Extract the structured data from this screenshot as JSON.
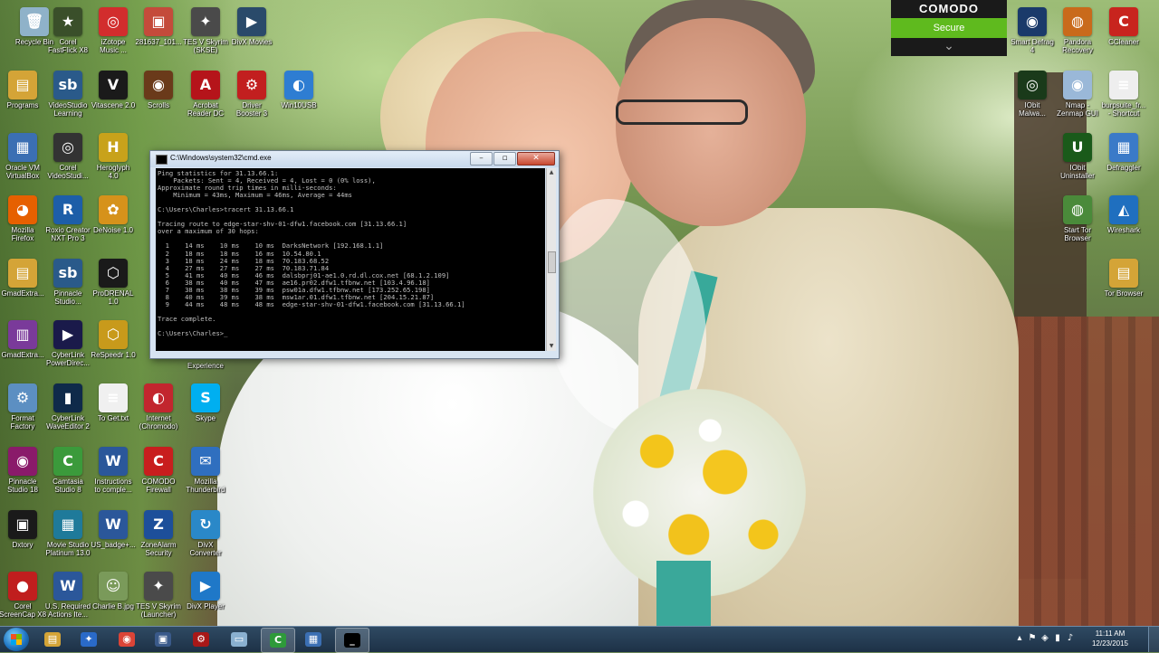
{
  "desktop": {
    "icons": [
      {
        "label": "Recycle Bin",
        "glyph": "🗑",
        "bg": "#8fb2c9"
      },
      {
        "label": "Corel\nFastFlick X8",
        "glyph": "★",
        "bg": "#3a4f2a"
      },
      {
        "label": "iZotope\nMusic ...",
        "glyph": "◎",
        "bg": "#d22d2d"
      },
      {
        "label": "281637_101...",
        "glyph": "▣",
        "bg": "#c44b3b"
      },
      {
        "label": "TES V Skyrim\n(SKSE)",
        "glyph": "✦",
        "bg": "#4a4a4a"
      },
      {
        "label": "DivX Movies",
        "glyph": "▶",
        "bg": "#2a4a6a"
      },
      {
        "label": "Programs",
        "glyph": "▤",
        "bg": "#d4a437"
      },
      {
        "label": "VideoStudio\nLearning",
        "glyph": "sb",
        "bg": "#2a5a8a"
      },
      {
        "label": "Vitascene 2.0",
        "glyph": "V",
        "bg": "#1a1a1a"
      },
      {
        "label": "Scrolls",
        "glyph": "◉",
        "bg": "#6a3a1a"
      },
      {
        "label": "Acrobat\nReader DC",
        "glyph": "A",
        "bg": "#b5141a"
      },
      {
        "label": "Driver\nBooster 3",
        "glyph": "⚙",
        "bg": "#c21f1f"
      },
      {
        "label": "Win10USB",
        "glyph": "◐",
        "bg": "#2e7dd2"
      },
      {
        "label": "Oracle VM\nVirtualBox",
        "glyph": "▦",
        "bg": "#3b6fb3"
      },
      {
        "label": "Corel\nVideoStudi...",
        "glyph": "◎",
        "bg": "#333"
      },
      {
        "label": "Heroglyph\n4.0",
        "glyph": "H",
        "bg": "#c8a21b"
      },
      {
        "label": "Mozilla\nFirefox",
        "glyph": "◕",
        "bg": "#e66000"
      },
      {
        "label": "Roxio Creator\nNXT Pro 3",
        "glyph": "R",
        "bg": "#1d5ea8"
      },
      {
        "label": "DeNoise 1.0",
        "glyph": "✿",
        "bg": "#d6921b"
      },
      {
        "label": "GmadExtra...",
        "glyph": "▤",
        "bg": "#d4a437"
      },
      {
        "label": "Pinnacle\nStudio...",
        "glyph": "sb",
        "bg": "#2a5a8a"
      },
      {
        "label": "ProDRENAL\n1.0",
        "glyph": "⬡",
        "bg": "#1a1a1a"
      },
      {
        "label": "GmadExtra...",
        "glyph": "▥",
        "bg": "#7a3a9a"
      },
      {
        "label": "CyberLink\nPowerDirec...",
        "glyph": "▶",
        "bg": "#1a1a4a"
      },
      {
        "label": "ReSpeedr 1.0",
        "glyph": "⬡",
        "bg": "#c89a1b"
      },
      {
        "label": "Experience",
        "glyph": "",
        "bg": "transparent"
      },
      {
        "label": "Format\nFactory",
        "glyph": "⚙",
        "bg": "#5c8fc2"
      },
      {
        "label": "CyberLink\nWaveEditor 2",
        "glyph": "▮",
        "bg": "#0f2a4a"
      },
      {
        "label": "To Get.txt",
        "glyph": "≡",
        "bg": "#f0f0f0"
      },
      {
        "label": "Internet\n(Chromodo)",
        "glyph": "◐",
        "bg": "#c2262e"
      },
      {
        "label": "Skype",
        "glyph": "S",
        "bg": "#00aff0"
      },
      {
        "label": "Pinnacle\nStudio 18",
        "glyph": "◉",
        "bg": "#8a1a6a"
      },
      {
        "label": "Camtasia\nStudio 8",
        "glyph": "C",
        "bg": "#3b9a3b"
      },
      {
        "label": "Instructions\nto comple...",
        "glyph": "W",
        "bg": "#2b579a"
      },
      {
        "label": "COMODO\nFirewall",
        "glyph": "C",
        "bg": "#c81e1e"
      },
      {
        "label": "Mozilla\nThunderbird",
        "glyph": "✉",
        "bg": "#2f6fbf"
      },
      {
        "label": "Dxtory",
        "glyph": "▣",
        "bg": "#1a1a1a"
      },
      {
        "label": "Movie Studio\nPlatinum 13.0",
        "glyph": "▦",
        "bg": "#1f7a9a"
      },
      {
        "label": "US_badge+...",
        "glyph": "W",
        "bg": "#2b579a"
      },
      {
        "label": "ZoneAlarm\nSecurity",
        "glyph": "Z",
        "bg": "#1d4f9a"
      },
      {
        "label": "DivX\nConverter",
        "glyph": "↻",
        "bg": "#2a88c8"
      },
      {
        "label": "Corel\nScreenCap X8",
        "glyph": "●",
        "bg": "#c01e1e"
      },
      {
        "label": "U.S. Required\nActions Ite...",
        "glyph": "W",
        "bg": "#2b579a"
      },
      {
        "label": "Charlie B.jpg",
        "glyph": "☺",
        "bg": "#7a9a5a"
      },
      {
        "label": "TES V Skyrim\n(Launcher)",
        "glyph": "✦",
        "bg": "#4a4a4a"
      },
      {
        "label": "DivX Player",
        "glyph": "▶",
        "bg": "#1f78c8"
      },
      {
        "label": "Smart Defrag\n4",
        "glyph": "◉",
        "bg": "#1a3a6a"
      },
      {
        "label": "Pandora\nRecovery",
        "glyph": "◍",
        "bg": "#c96a1b"
      },
      {
        "label": "CCleaner",
        "glyph": "C",
        "bg": "#c8241e"
      },
      {
        "label": "IObit\nMalwa...",
        "glyph": "◎",
        "bg": "#1a3a1a"
      },
      {
        "label": "Nmap -\nZenmap GUI",
        "glyph": "◉",
        "bg": "#9ab8d8"
      },
      {
        "label": "burpsuite_fr...\n- Shortcut",
        "glyph": "≡",
        "bg": "#eeeeee"
      },
      {
        "label": "IObit\nUninstaller",
        "glyph": "U",
        "bg": "#1a5a1a"
      },
      {
        "label": "Defraggler",
        "glyph": "▦",
        "bg": "#3a7ac8"
      },
      {
        "label": "Start Tor\nBrowser",
        "glyph": "◍",
        "bg": "#4a8a3a"
      },
      {
        "label": "Wireshark",
        "glyph": "◭",
        "bg": "#1f6fbf"
      },
      {
        "label": "Tor Browser",
        "glyph": "▤",
        "bg": "#d4a437"
      }
    ]
  },
  "comodo": {
    "brand": "COMODO",
    "status": "Secure",
    "expand_icon": "chevron-down"
  },
  "cmd": {
    "title": "C:\\Windows\\system32\\cmd.exe",
    "minimize": "–",
    "maximize": "▫",
    "close": "✕",
    "console_text": "Ping statistics for 31.13.66.1:\n    Packets: Sent = 4, Received = 4, Lost = 0 (0% loss),\nApproximate round trip times in milli-seconds:\n    Minimum = 43ms, Maximum = 46ms, Average = 44ms\n\nC:\\Users\\Charles>tracert 31.13.66.1\n\nTracing route to edge-star-shv-01-dfw1.facebook.com [31.13.66.1]\nover a maximum of 30 hops:\n\n  1    14 ms    10 ms    10 ms  DarksNetwork [192.168.1.1]\n  2    18 ms    18 ms    16 ms  10.54.80.1\n  3    18 ms    24 ms    18 ms  70.183.68.52\n  4    27 ms    27 ms    27 ms  70.183.71.84\n  5    41 ms    40 ms    46 ms  dalsbprj01-ae1.0.rd.dl.cox.net [68.1.2.109]\n  6    38 ms    40 ms    47 ms  ae16.pr02.dfw1.tfbnw.net [103.4.96.18]\n  7    38 ms    38 ms    39 ms  psw01a.dfw1.tfbnw.net [173.252.65.198]\n  8    40 ms    39 ms    38 ms  msw1ar.01.dfw1.tfbnw.net [204.15.21.87]\n  9    44 ms    48 ms    48 ms  edge-star-shv-01-dfw1.facebook.com [31.13.66.1]\n\nTrace complete.\n\nC:\\Users\\Charles>_"
  },
  "taskbar": {
    "pinned": [
      {
        "name": "windows-explorer-taskbar-icon",
        "glyph": "▤",
        "bg": "#d4a437"
      },
      {
        "name": "media-taskbar-icon",
        "glyph": "✦",
        "bg": "#2a6ac8"
      },
      {
        "name": "chrome-taskbar-icon",
        "glyph": "◉",
        "bg": "#db4437"
      },
      {
        "name": "network-tool-taskbar-icon",
        "glyph": "▣",
        "bg": "#3a5a8a"
      },
      {
        "name": "driver-booster-taskbar-icon",
        "glyph": "⚙",
        "bg": "#a81818"
      },
      {
        "name": "folder-taskbar-icon",
        "glyph": "▭",
        "bg": "#8ab0d0"
      },
      {
        "name": "chromodo-taskbar-icon",
        "glyph": "C",
        "bg": "#2e9a3a"
      },
      {
        "name": "virtualbox-taskbar-icon",
        "glyph": "▦",
        "bg": "#3b6fb3"
      },
      {
        "name": "cmd-taskbar-icon",
        "glyph": "_",
        "bg": "#000000"
      }
    ],
    "clock_time": "11:11 AM",
    "clock_date": "12/23/2015"
  }
}
